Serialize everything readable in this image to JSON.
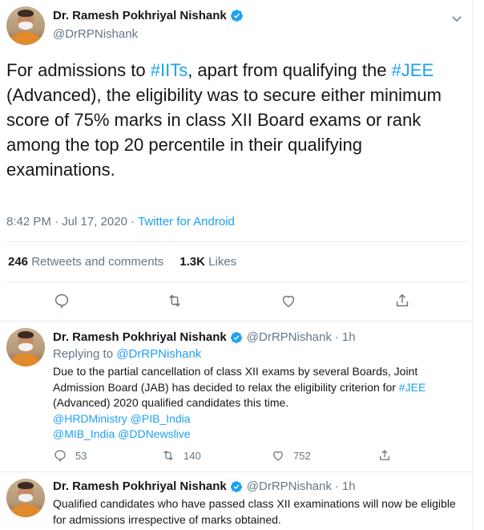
{
  "main_tweet": {
    "author_name": "Dr. Ramesh Pokhriyal Nishank",
    "handle": "@DrRPNishank",
    "text_parts": {
      "p1": "For admissions to ",
      "h1": "#IITs",
      "p2": ", apart from qualifying the ",
      "h2": "#JEE",
      "p3": " (Advanced), the eligibility was to secure either minimum score of 75% marks in class XII Board exams or rank among the top 20 percentile in their qualifying examinations."
    },
    "time": "8:42 PM · Jul 17, 2020 · ",
    "source": "Twitter for Android",
    "retweets_count": "246",
    "retweets_label": "Retweets and comments",
    "likes_count": "1.3K",
    "likes_label": "Likes"
  },
  "replies": [
    {
      "author_name": "Dr. Ramesh Pokhriyal Nishank",
      "handle": "@DrRPNishank",
      "dot": "·",
      "time": "1h",
      "replying_prefix": "Replying to ",
      "replying_to": "@DrRPNishank",
      "text_parts": {
        "p1": "Due to the partial cancellation of class XII exams by several Boards, Joint Admission Board (JAB) has decided to relax the eligibility criterion for ",
        "h1": "#JEE",
        "p2": " (Advanced) 2020 qualified candidates this time."
      },
      "mentions_line1": [
        "@HRDMinistry",
        "@PIB_India"
      ],
      "mentions_line2": [
        "@MIB_India",
        "@DDNewslive"
      ],
      "comments": "53",
      "retweets": "140",
      "likes": "752"
    },
    {
      "author_name": "Dr. Ramesh Pokhriyal Nishank",
      "handle": "@DrRPNishank",
      "dot": "·",
      "time": "1h",
      "text": "Qualified candidates who have passed class XII examinations will now be eligible for admissions irrespective of marks obtained."
    }
  ],
  "colors": {
    "link": "#1da1f2",
    "muted": "#657786",
    "text": "#14171a",
    "border": "#e6ecf0"
  }
}
